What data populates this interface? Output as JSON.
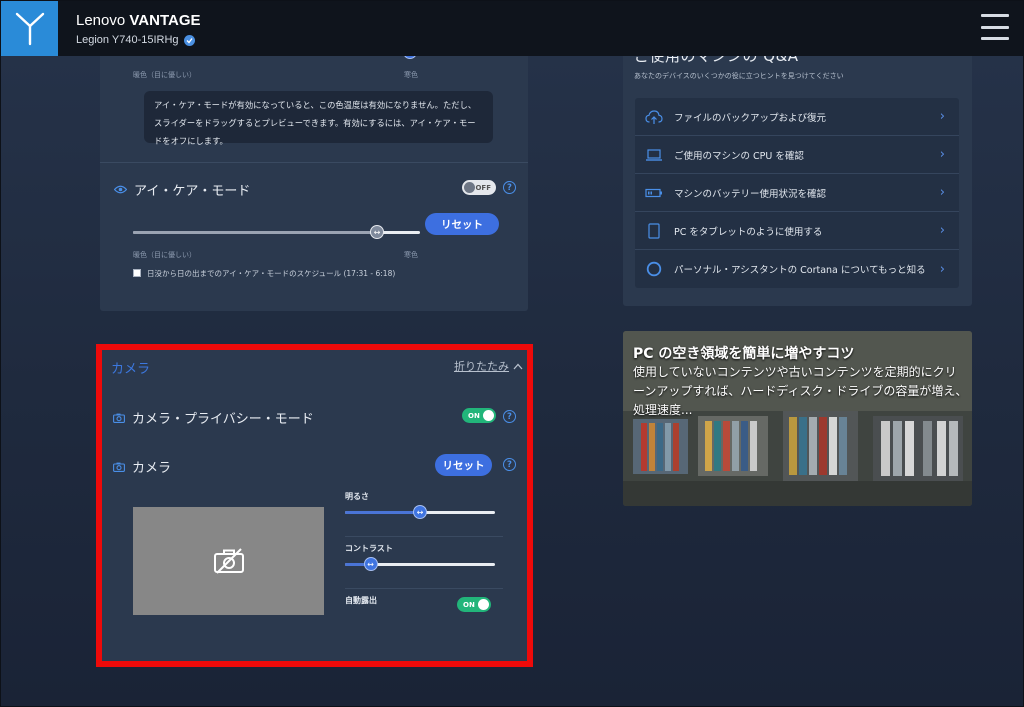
{
  "header": {
    "brand": "Lenovo",
    "product": "VANTAGE",
    "device": "Legion Y740-15IRHg"
  },
  "color_panel": {
    "warm_label_top": "暖色（目に優しい）",
    "cool_label_top": "寒色",
    "tip": "アイ・ケア・モードが有効になっていると、この色温度は有効になりません。ただし、スライダーをドラッグするとプレビューできます。有効にするには、アイ・ケア・モードをオフにします。",
    "eye_care": {
      "title": "アイ・ケア・モード",
      "toggle": "OFF",
      "reset": "リセット",
      "warm_label": "暖色（目に優しい）",
      "cool_label": "寒色",
      "slider_value": 0.85,
      "schedule": "日没から日の出までのアイ・ケア・モードのスケジュール (17:31 - 6:18)"
    }
  },
  "camera": {
    "heading": "カメラ",
    "collapse": "折りたたみ",
    "privacy_title": "カメラ・プライバシー・モード",
    "privacy_toggle": "ON",
    "camera_title": "カメラ",
    "reset": "リセット",
    "brightness_label": "明るさ",
    "brightness_value": 0.5,
    "contrast_label": "コントラスト",
    "contrast_value": 0.17,
    "auto_exposure_label": "自動露出",
    "auto_exposure_toggle": "ON"
  },
  "qa": {
    "title": "ご使用のマシンの Q&A",
    "subtitle": "あなたのデバイスのいくつかの役に立つヒントを見つけてください",
    "items": [
      {
        "label": "ファイルのバックアップおよび復元",
        "icon": "cloud-upload-icon"
      },
      {
        "label": "ご使用のマシンの CPU を確認",
        "icon": "laptop-icon"
      },
      {
        "label": "マシンのバッテリー使用状況を確認",
        "icon": "battery-icon"
      },
      {
        "label": "PC をタブレットのように使用する",
        "icon": "tablet-icon"
      },
      {
        "label": "パーソナル・アシスタントの Cortana についてもっと知る",
        "icon": "cortana-icon"
      }
    ]
  },
  "article": {
    "title": "PC の空き領域を簡単に増やすコツ",
    "body": "使用していないコンテンツや古いコンテンツを定期的にクリーンアップすれば、ハードディスク・ドライブの容量が増え、処理速度..."
  },
  "colors": {
    "accent": "#3d6fe0",
    "toggle_on": "#22b57a",
    "highlight": "#ee0a0a"
  }
}
